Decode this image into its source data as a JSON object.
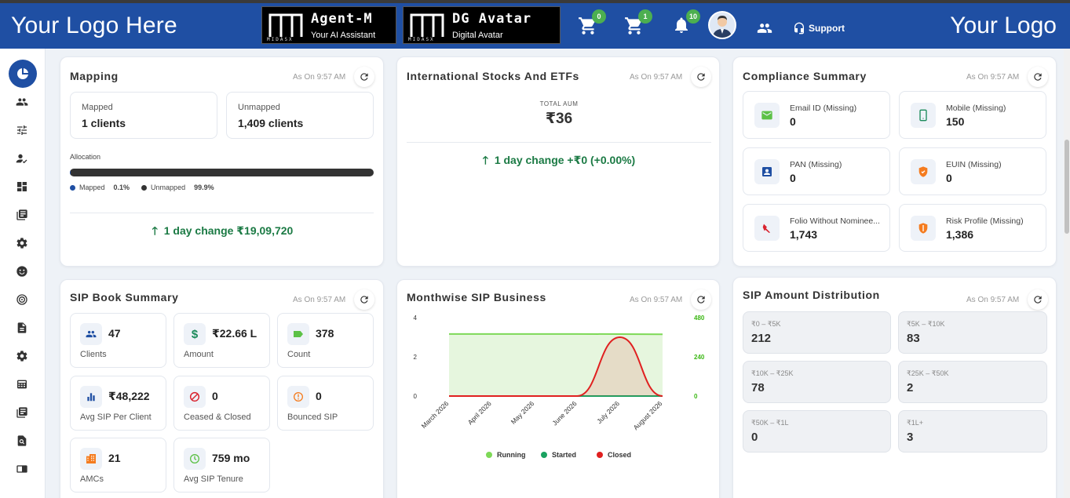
{
  "header": {
    "logo_left": "Your Logo Here",
    "logo_right": "Your Logo",
    "brands": [
      {
        "title": "Agent-M",
        "subtitle": "Your AI Assistant",
        "mark_text": "MIDASX"
      },
      {
        "title": "DG Avatar",
        "subtitle": "Digital Avatar",
        "mark_text": "MIDASX"
      }
    ],
    "cart1_badge": "0",
    "cart2_badge": "1",
    "notif_badge": "10",
    "support_label": "Support"
  },
  "mapping": {
    "title": "Mapping",
    "as_of": "As On 9:57 AM",
    "mapped_label": "Mapped",
    "mapped_value": "1 clients",
    "unmapped_label": "Unmapped",
    "unmapped_value": "1,409 clients",
    "allocation_label": "Allocation",
    "legend_mapped": "Mapped",
    "legend_mapped_pct": "0.1%",
    "legend_unmapped": "Unmapped",
    "legend_unmapped_pct": "99.9%",
    "mapped_fraction": 0.001,
    "change": "1 day change ₹19,09,720"
  },
  "intl": {
    "title": "International Stocks And ETFs",
    "as_of": "As On 9:57 AM",
    "aum_label": "TOTAL AUM",
    "aum_value": "₹36",
    "change": "1 day change +₹0 (+0.00%)"
  },
  "compliance": {
    "title": "Compliance Summary",
    "as_of": "As On 9:57 AM",
    "items": [
      {
        "label": "Email ID (Missing)",
        "value": "0",
        "icon": "email-icon"
      },
      {
        "label": "Mobile (Missing)",
        "value": "150",
        "icon": "mobile-icon"
      },
      {
        "label": "PAN (Missing)",
        "value": "0",
        "icon": "id-card-icon"
      },
      {
        "label": "EUIN (Missing)",
        "value": "0",
        "icon": "shield-icon"
      },
      {
        "label": "Folio Without Nominee...",
        "value": "1,743",
        "icon": "nominee-icon"
      },
      {
        "label": "Risk Profile (Missing)",
        "value": "1,386",
        "icon": "shield-icon"
      }
    ]
  },
  "sip_book": {
    "title": "SIP Book Summary",
    "as_of": "As On 9:57 AM",
    "tiles": [
      {
        "value": "47",
        "label": "Clients",
        "icon": "users-icon"
      },
      {
        "value": "₹22.66 L",
        "label": "Amount",
        "icon": "dollar-icon"
      },
      {
        "value": "378",
        "label": "Count",
        "icon": "tag-icon"
      },
      {
        "value": "₹48,222",
        "label": "Avg SIP Per Client",
        "icon": "bar-chart-icon"
      },
      {
        "value": "0",
        "label": "Ceased & Closed",
        "icon": "ban-icon"
      },
      {
        "value": "0",
        "label": "Bounced SIP",
        "icon": "alert-icon"
      },
      {
        "value": "21",
        "label": "AMCs",
        "icon": "building-icon"
      },
      {
        "value": "759 mo",
        "label": "Avg SIP Tenure",
        "icon": "clock-icon"
      }
    ]
  },
  "monthwise": {
    "title": "Monthwise SIP Business",
    "as_of": "As On 9:57 AM"
  },
  "chart_data": {
    "type": "area",
    "categories": [
      "March 2026",
      "April 2026",
      "May 2026",
      "June 2026",
      "July 2026",
      "August 2026"
    ],
    "series": [
      {
        "name": "Running",
        "axis": "right",
        "values": [
          380,
          380,
          380,
          380,
          379,
          378
        ],
        "color": "#7ed957"
      },
      {
        "name": "Started",
        "axis": "left",
        "values": [
          0,
          0,
          0,
          0,
          0,
          0
        ],
        "color": "#1aa260"
      },
      {
        "name": "Closed",
        "axis": "left",
        "values": [
          0,
          0,
          0,
          0,
          3,
          0
        ],
        "color": "#e02020"
      }
    ],
    "ylim_left": [
      0,
      4
    ],
    "yticks_left": [
      "4",
      "2",
      "0"
    ],
    "ylim_right": [
      0,
      480
    ],
    "yticks_right": [
      "480",
      "240",
      "0"
    ],
    "legend_position": "bottom"
  },
  "distribution": {
    "title": "SIP Amount Distribution",
    "as_of": "As On 9:57 AM",
    "items": [
      {
        "label": "₹0 – ₹5K",
        "value": "212"
      },
      {
        "label": "₹5K – ₹10K",
        "value": "83"
      },
      {
        "label": "₹10K – ₹25K",
        "value": "78"
      },
      {
        "label": "₹25K – ₹50K",
        "value": "2"
      },
      {
        "label": "₹50K – ₹1L",
        "value": "0"
      },
      {
        "label": "₹1L+",
        "value": "3"
      }
    ]
  }
}
